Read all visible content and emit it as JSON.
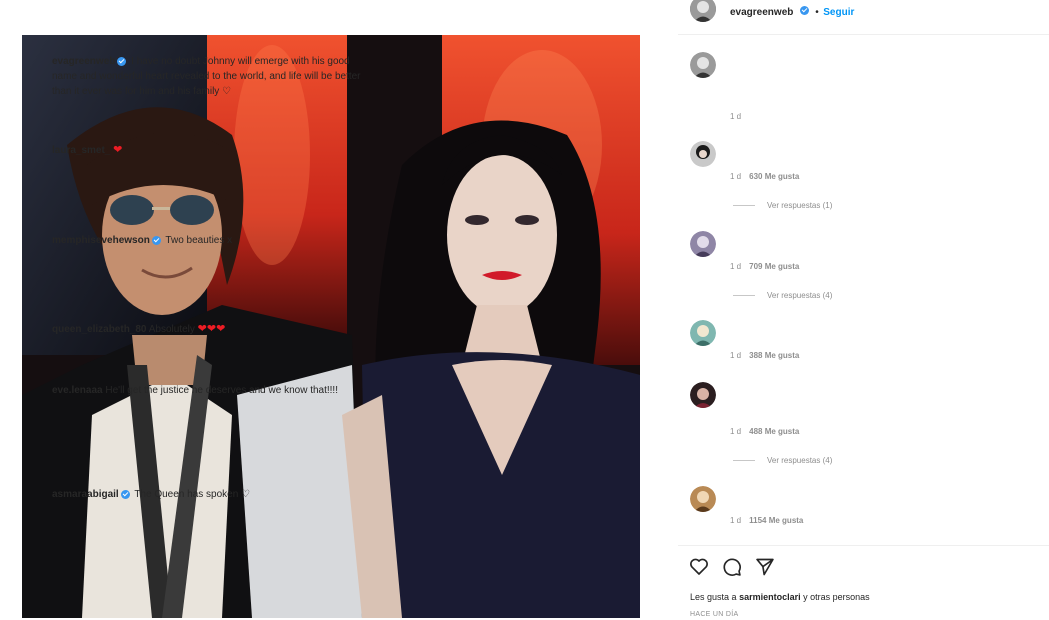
{
  "post": {
    "author": "evagreenweb",
    "follow_label": "Seguir",
    "caption_author": "evagreenweb",
    "caption_text": "I have no doubt Johnny will emerge with his good name and wonderful heart revealed to the world, and life will be better than it ever was for him and his family ♡",
    "caption_time": "1 d"
  },
  "comments": [
    {
      "user": "laura_smet_",
      "text": "",
      "hearts": 1,
      "time": "1 d",
      "likes": "630 Me gusta",
      "replies": "Ver respuestas (1)"
    },
    {
      "user": "memphisevehewson",
      "verified": true,
      "text": "Two beauties x",
      "time": "1 d",
      "likes": "709 Me gusta",
      "replies": "Ver respuestas (4)"
    },
    {
      "user": "queen_elizabeth_80",
      "text": "Absolutely",
      "hearts": 3,
      "time": "1 d",
      "likes": "388 Me gusta"
    },
    {
      "user": "eve.lenaaa",
      "text": "He'll get the justice he deserves and we know that!!!!",
      "time": "1 d",
      "likes": "488 Me gusta",
      "replies": "Ver respuestas (4)"
    },
    {
      "user": "asmaraabigail",
      "verified": true,
      "text": "The Queen has spoken ♡",
      "time": "1 d",
      "likes": "1154 Me gusta"
    }
  ],
  "likes_bar": {
    "prefix": "Les gusta a",
    "user": "sarmientoclari",
    "suffix": "y otras personas",
    "date": "HACE UN DÍA"
  },
  "colors": {
    "verified": "#3897f0",
    "heart": "#ed1c24",
    "follow": "#0095f6"
  },
  "icons": [
    "heart-icon",
    "comment-icon",
    "share-icon",
    "verified-icon"
  ]
}
